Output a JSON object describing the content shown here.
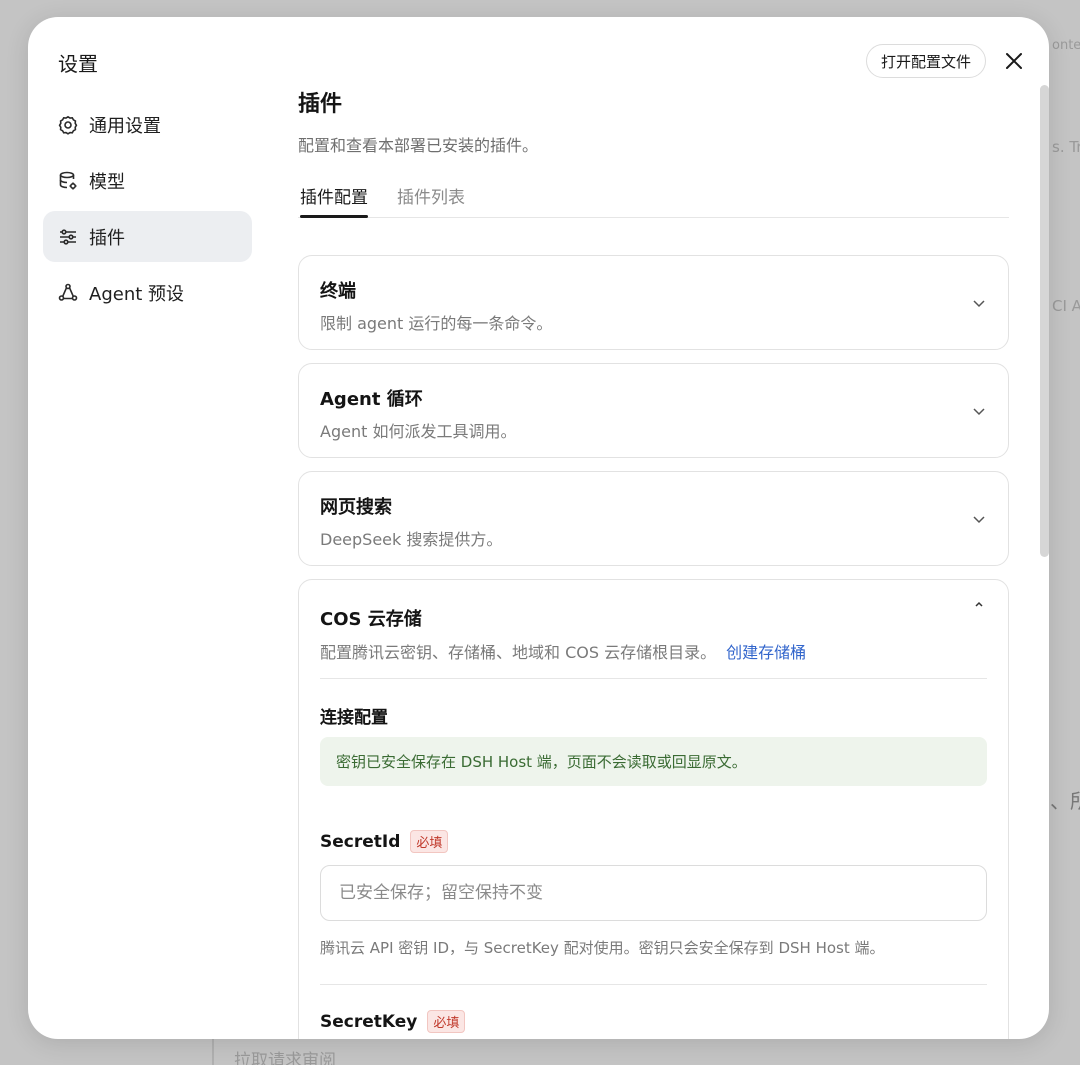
{
  "background": {
    "fragments": [
      "onte",
      "s. Tr",
      "CI A",
      "、所",
      "拉取请求审阅"
    ]
  },
  "modal": {
    "title": "设置",
    "open_config_label": "打开配置文件",
    "close_icon": "close-icon"
  },
  "nav": {
    "items": [
      {
        "label": "通用设置",
        "icon": "gear-icon",
        "active": false
      },
      {
        "label": "模型",
        "icon": "database-icon",
        "active": false
      },
      {
        "label": "插件",
        "icon": "sliders-icon",
        "active": true
      },
      {
        "label": "Agent 预设",
        "icon": "agent-icon",
        "active": false
      }
    ]
  },
  "main": {
    "title": "插件",
    "subtitle": "配置和查看本部署已安装的插件。",
    "tabs": [
      {
        "label": "插件配置",
        "active": true
      },
      {
        "label": "插件列表",
        "active": false
      }
    ]
  },
  "plugins": [
    {
      "title": "终端",
      "desc": "限制 agent 运行的每一条命令。",
      "expanded": false
    },
    {
      "title": "Agent 循环",
      "desc": "Agent 如何派发工具调用。",
      "expanded": false
    },
    {
      "title": "网页搜索",
      "desc": "DeepSeek 搜索提供方。",
      "expanded": false
    },
    {
      "title": "COS 云存储",
      "desc": "配置腾讯云密钥、存储桶、地域和 COS 云存储根目录。",
      "link": "创建存储桶",
      "expanded": true,
      "section_title": "连接配置",
      "notice": "密钥已安全保存在 DSH Host 端，页面不会读取或回显原文。",
      "fields": [
        {
          "label": "SecretId",
          "required_label": "必填",
          "placeholder": "已安全保存；留空保持不变",
          "help": "腾讯云 API 密钥 ID，与 SecretKey 配对使用。密钥只会安全保存到 DSH Host 端。"
        },
        {
          "label": "SecretKey",
          "required_label": "必填"
        }
      ]
    }
  ],
  "colors": {
    "accent_link": "#3366cc",
    "notice_bg": "#eef4ec",
    "notice_text": "#3a6b33",
    "required": "#c0392b"
  }
}
